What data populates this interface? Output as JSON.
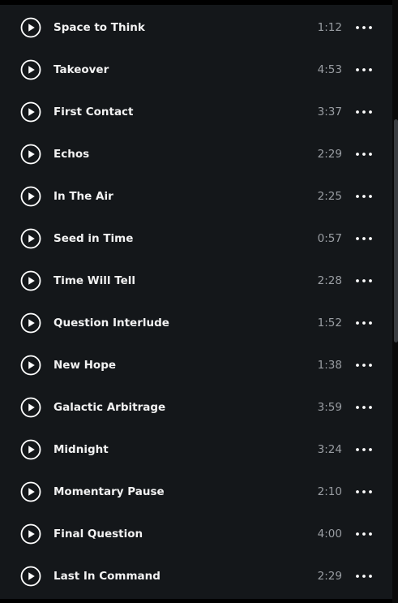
{
  "tracks": [
    {
      "title": "Space to Think",
      "duration": "1:12"
    },
    {
      "title": "Takeover",
      "duration": "4:53"
    },
    {
      "title": "First Contact",
      "duration": "3:37"
    },
    {
      "title": "Echos",
      "duration": "2:29"
    },
    {
      "title": "In The Air",
      "duration": "2:25"
    },
    {
      "title": "Seed in Time",
      "duration": "0:57"
    },
    {
      "title": "Time Will Tell",
      "duration": "2:28"
    },
    {
      "title": "Question Interlude",
      "duration": "1:52"
    },
    {
      "title": "New Hope",
      "duration": "1:38"
    },
    {
      "title": "Galactic Arbitrage",
      "duration": "3:59"
    },
    {
      "title": "Midnight",
      "duration": "3:24"
    },
    {
      "title": "Momentary Pause",
      "duration": "2:10"
    },
    {
      "title": "Final Question",
      "duration": "4:00"
    },
    {
      "title": "Last In Command",
      "duration": "2:29"
    }
  ],
  "icons": {
    "play": "play-circle-icon",
    "more": "more-horizontal-icon"
  },
  "colors": {
    "panel_background": "#14171a",
    "title_text": "#f2f2f2",
    "duration_text": "#9a9ea3",
    "icon": "#ffffff"
  }
}
